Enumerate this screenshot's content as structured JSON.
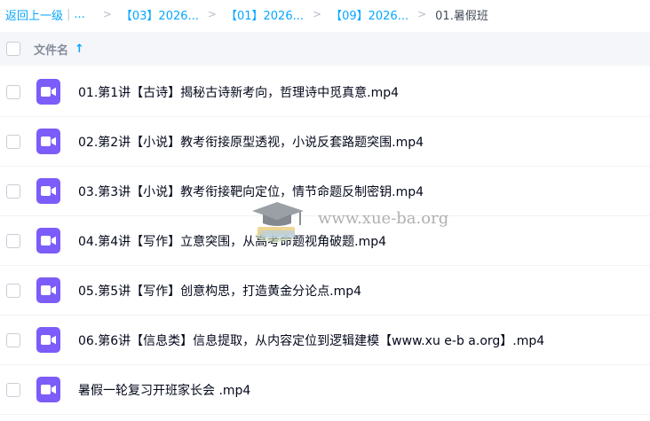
{
  "breadcrumb": {
    "back_label": "返回上一级",
    "separator": "|",
    "ellipsis": "...",
    "items": [
      "【03】2026...",
      "【01】2026...",
      "【09】2026..."
    ],
    "chevron": ">",
    "current": "01.暑假班"
  },
  "header": {
    "filename_label": "文件名",
    "sort_arrow": "↑"
  },
  "files": [
    {
      "name": "01.第1讲【古诗】揭秘古诗新考向，哲理诗中觅真意.mp4"
    },
    {
      "name": "02.第2讲【小说】教考衔接原型透视，小说反套路题突围.mp4"
    },
    {
      "name": "03.第3讲【小说】教考衔接靶向定位，情节命题反制密钥.mp4"
    },
    {
      "name": "04.第4讲【写作】立意突围，从高考命题视角破题.mp4"
    },
    {
      "name": "05.第5讲【写作】创意构思，打造黄金分论点.mp4"
    },
    {
      "name": "06.第6讲【信息类】信息提取，从内容定位到逻辑建模【www.xu e-b a.org】.mp4"
    },
    {
      "name": "暑假一轮复习开班家长会 .mp4"
    }
  ],
  "watermark": {
    "text": "www.xue-ba.org"
  },
  "colors": {
    "link": "#06a7ff",
    "video_icon": "#7c5cfa",
    "header_bg": "#f5f6fa"
  }
}
